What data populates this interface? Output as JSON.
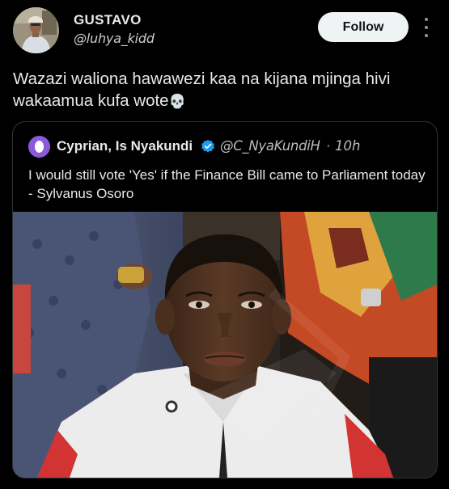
{
  "author": {
    "name": "GUSTAVO",
    "handle": "@luhya_kidd",
    "follow_label": "Follow"
  },
  "tweet": {
    "text": "Wazazi waliona hawawezi kaa na kijana mjinga hivi wakaamua kufa wote",
    "emoji": "💀"
  },
  "quoted": {
    "author_name": "Cyprian, Is Nyakundi",
    "handle": "@C_NyaKundiH",
    "separator": "·",
    "time": "10h",
    "text": "I would still vote 'Yes' if the Finance Bill came to Parliament today - Sylvanus Osoro"
  },
  "icons": {
    "more": "more-vertical-icon",
    "verified": "verified-badge-icon"
  },
  "colors": {
    "background": "#000000",
    "follow_button_bg": "#eff3f4",
    "verified_blue": "#1d9bf0",
    "quote_avatar": "#8c5ad8"
  }
}
